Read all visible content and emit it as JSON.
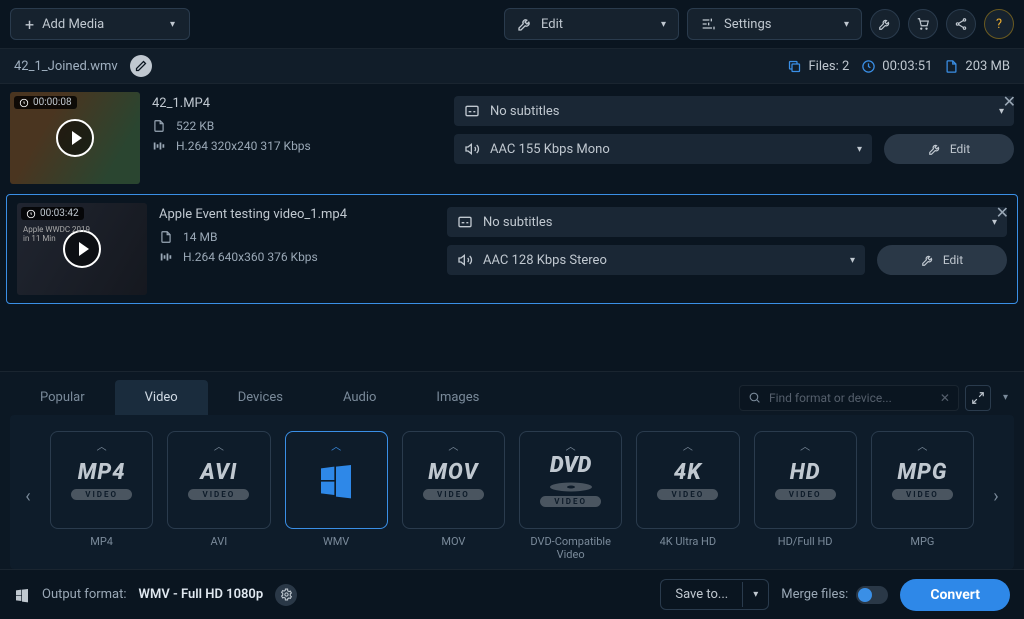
{
  "toolbar": {
    "add_media": "Add Media",
    "edit": "Edit",
    "settings": "Settings"
  },
  "infobar": {
    "output_filename": "42_1_Joined.wmv",
    "files_label": "Files: 2",
    "duration": "00:03:51",
    "size": "203 MB"
  },
  "files": [
    {
      "duration_badge": "00:00:08",
      "title": "42_1.MP4",
      "size": "522 KB",
      "codec": "H.264 320x240 317 Kbps",
      "subtitles": "No subtitles",
      "audio": "AAC 155 Kbps Mono",
      "edit": "Edit"
    },
    {
      "duration_badge": "00:03:42",
      "title": "Apple Event testing video_1.mp4",
      "size": "14 MB",
      "codec": "H.264 640x360 376 Kbps",
      "subtitles": "No subtitles",
      "audio": "AAC 128 Kbps Stereo",
      "edit": "Edit",
      "thumb_text1": "Apple WWDC 2019",
      "thumb_text2": "in 11 Min"
    }
  ],
  "tabs": {
    "popular": "Popular",
    "video": "Video",
    "devices": "Devices",
    "audio": "Audio",
    "images": "Images",
    "search_placeholder": "Find format or device..."
  },
  "formats": [
    {
      "main": "MP4",
      "pill": "VIDEO",
      "label": "MP4"
    },
    {
      "main": "AVI",
      "pill": "VIDEO",
      "label": "AVI"
    },
    {
      "main": "WIN",
      "pill": "",
      "label": "WMV",
      "selected": true
    },
    {
      "main": "MOV",
      "pill": "VIDEO",
      "label": "MOV"
    },
    {
      "main": "DVD",
      "pill": "VIDEO",
      "label": "DVD-Compatible Video"
    },
    {
      "main": "4K",
      "pill": "VIDEO",
      "label": "4K Ultra HD"
    },
    {
      "main": "HD",
      "pill": "VIDEO",
      "label": "HD/Full HD"
    },
    {
      "main": "MPG",
      "pill": "VIDEO",
      "label": "MPG"
    }
  ],
  "bottom": {
    "out_label": "Output format:",
    "out_value": "WMV - Full HD 1080p",
    "save_to": "Save to...",
    "merge_label": "Merge files:",
    "convert": "Convert"
  }
}
